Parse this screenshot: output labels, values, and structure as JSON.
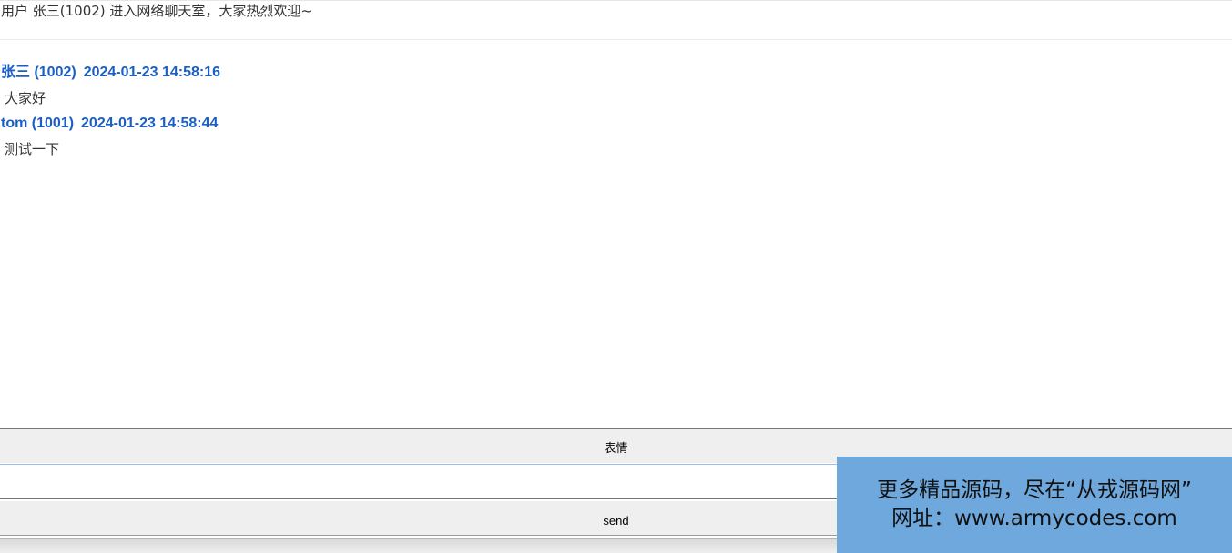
{
  "system_notice": "用户 张三(1002) 进入网络聊天室，大家热烈欢迎~",
  "messages": [
    {
      "sender": "张三 (1002)",
      "time": "2024-01-23 14:58:16",
      "text": "大家好"
    },
    {
      "sender": "tom (1001)",
      "time": "2024-01-23 14:58:44",
      "text": "测试一下"
    }
  ],
  "controls": {
    "emoji_label": "表情",
    "input_value": "",
    "input_placeholder": "",
    "send_label": "send"
  },
  "watermark": {
    "line1": "更多精品源码，尽在“从戎源码网”",
    "line2": "网址：www.armycodes.com"
  },
  "colors": {
    "sender": "#1a5fc6",
    "watermark_bg": "#6fa8dc"
  }
}
